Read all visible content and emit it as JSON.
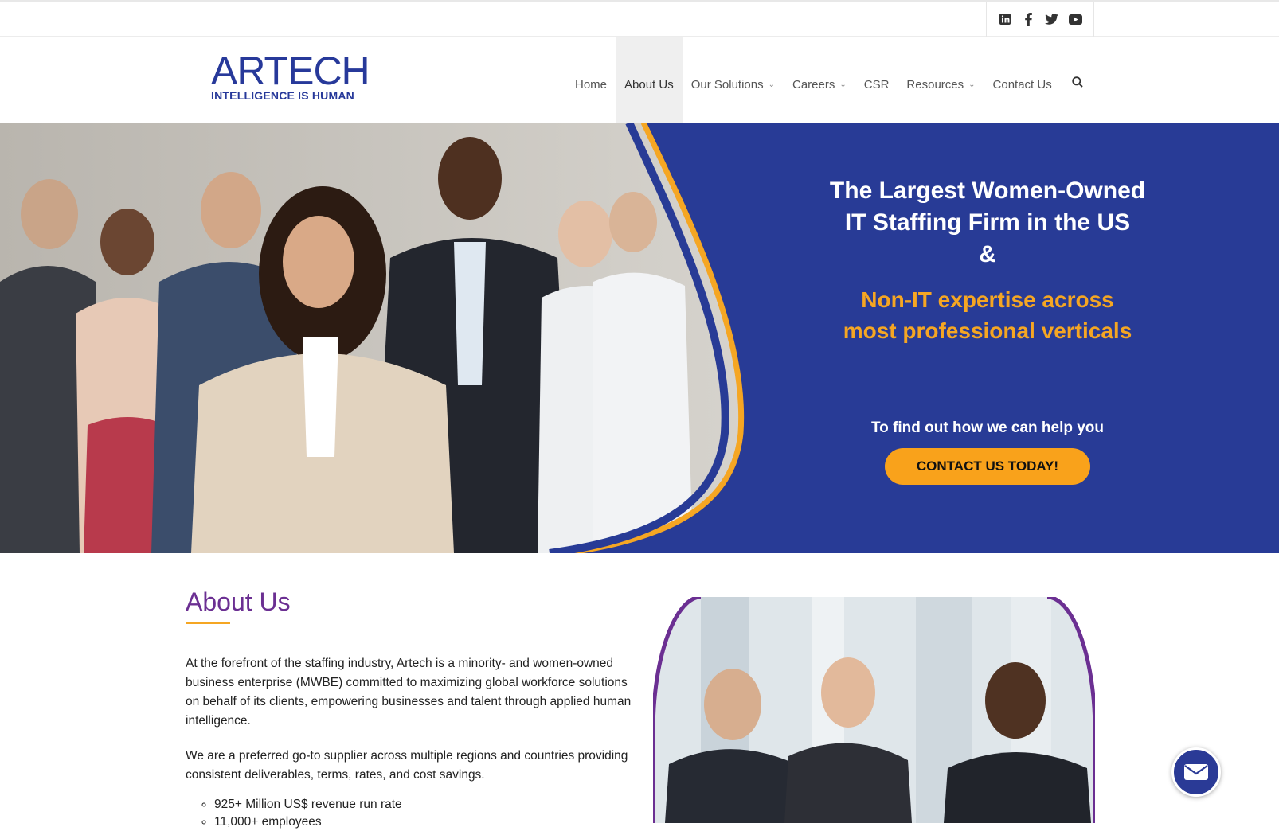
{
  "social": {
    "icons": [
      "linkedin-icon",
      "facebook-icon",
      "twitter-icon",
      "youtube-icon"
    ]
  },
  "logo": {
    "wordmark": "ARTECH",
    "tagline": "INTELLIGENCE IS HUMAN"
  },
  "nav": {
    "items": [
      {
        "label": "Home"
      },
      {
        "label": "About Us"
      },
      {
        "label": "Our Solutions"
      },
      {
        "label": "Careers"
      },
      {
        "label": "CSR"
      },
      {
        "label": "Resources"
      },
      {
        "label": "Contact Us"
      }
    ]
  },
  "hero": {
    "line1": "The Largest Women-Owned",
    "line2": "IT Staffing Firm in the US",
    "line3": "&",
    "orange1": "Non-IT expertise across",
    "orange2": "most professional verticals",
    "prompt": "To find out how we can help you",
    "cta": "CONTACT US TODAY!"
  },
  "about": {
    "title": "About Us",
    "p1": "At the forefront of the staffing industry, Artech is a minority- and women-owned business enterprise (MWBE) committed to maximizing global workforce solutions on behalf of its clients, empowering businesses and talent through applied human intelligence.",
    "p2": "We are a preferred go-to supplier across multiple regions and countries providing consistent deliverables, terms, rates, and cost savings.",
    "bullets": [
      "925+ Million US$ revenue run rate",
      "11,000+ employees"
    ]
  },
  "colors": {
    "brand_blue": "#283b96",
    "accent_orange": "#f5a623",
    "about_purple": "#6b2f92"
  }
}
